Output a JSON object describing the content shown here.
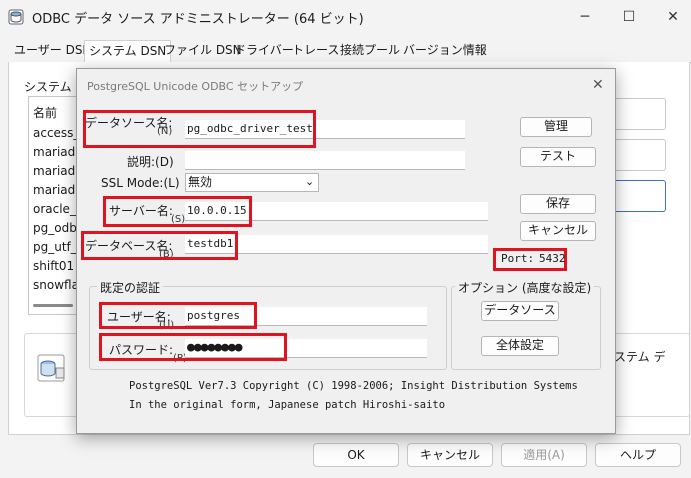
{
  "main_window": {
    "title": "ODBC データ ソース アドミニストレーター (64 ビット)",
    "tabs": [
      {
        "label": "ユーザー DSN"
      },
      {
        "label": "システム DSN"
      },
      {
        "label": "ファイル DSN"
      },
      {
        "label": "ドライバー"
      },
      {
        "label": "トレース"
      },
      {
        "label": "接続プール"
      },
      {
        "label": "バージョン情報"
      }
    ],
    "list_label": "システム デ",
    "list_header": "名前",
    "dsn_items": [
      "access_t",
      "mariadb",
      "mariadb",
      "mariadb",
      "oracle_o",
      "pg_odbc",
      "pg_utf_t",
      "shift01",
      "snowflak"
    ],
    "desc_right": "ステム デ",
    "buttons": {
      "ok": "OK",
      "cancel": "キャンセル",
      "apply": "適用(A)",
      "help": "ヘルプ"
    }
  },
  "dialog": {
    "title": "PostgreSQL Unicode ODBC セットアップ",
    "fields": {
      "data_source": {
        "label": "データソース名:",
        "mnemonic": "(N)",
        "value": "pg_odbc_driver_test"
      },
      "description": {
        "label": "説明:(D)",
        "value": ""
      },
      "ssl_mode": {
        "label": "SSL Mode:(L)",
        "value": "無効"
      },
      "server": {
        "label": "サーバー名:",
        "mnemonic": "(S)",
        "value": "10.0.0.15"
      },
      "database": {
        "label": "データベース名:",
        "mnemonic": "(B)",
        "value": "testdb1"
      },
      "port": {
        "label": "Port:",
        "value": "5432"
      },
      "user": {
        "label": "ユーザー名:",
        "mnemonic": "(U)",
        "value": "postgres"
      },
      "password": {
        "label": "パスワード:",
        "mnemonic": "(P)",
        "value": "●●●●●●●●"
      }
    },
    "buttons": {
      "manage": "管理",
      "test": "テスト",
      "save": "保存",
      "cancel": "キャンセル",
      "datasource": "データソース",
      "global": "全体設定"
    },
    "auth_group": "既定の認証",
    "options_group": "オプション (高度な設定)",
    "info_line1": "PostgreSQL Ver7.3  Copyright (C) 1998-2006; Insight Distribution Systems",
    "info_line2": "In the original form, Japanese patch Hiroshi-saito"
  },
  "colors": {
    "highlight": "#e0141f",
    "window_bg": "#f3f3f3",
    "dialog_bg": "#f0f0f0"
  },
  "icons": [
    "odbc-app-icon",
    "minimize-icon",
    "maximize-icon",
    "close-icon",
    "chevron-down-icon",
    "database-icon"
  ]
}
